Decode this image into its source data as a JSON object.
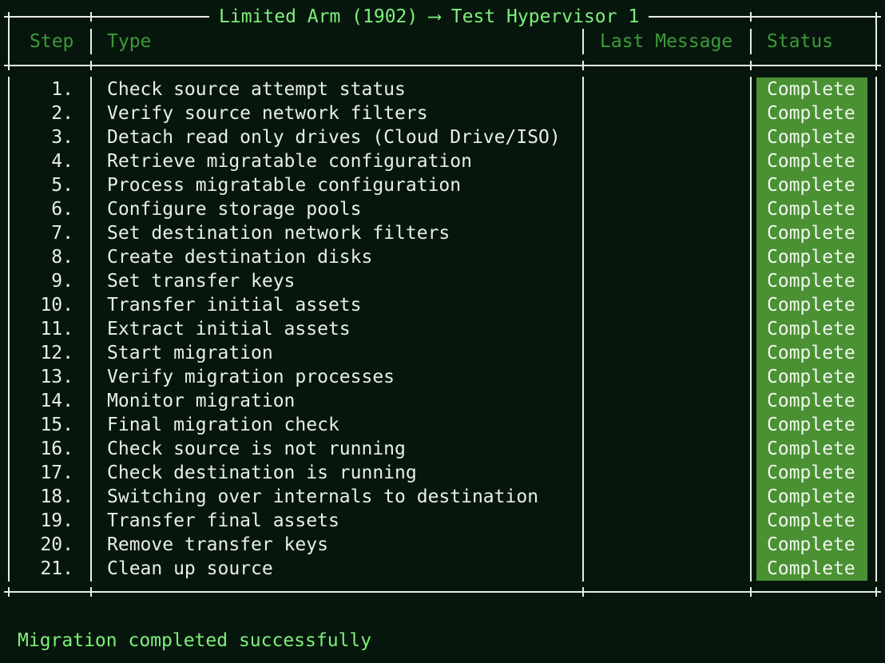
{
  "window": {
    "title": "Limited Arm (1902) ⟶ Test Hypervisor 1"
  },
  "table": {
    "headers": {
      "step": "Step",
      "type": "Type",
      "last_message": "Last Message",
      "status": "Status"
    },
    "rows": [
      {
        "step": "1.",
        "type": "Check source attempt status",
        "last_message": "",
        "status": "Complete"
      },
      {
        "step": "2.",
        "type": "Verify source network filters",
        "last_message": "",
        "status": "Complete"
      },
      {
        "step": "3.",
        "type": "Detach read only drives (Cloud Drive/ISO)",
        "last_message": "",
        "status": "Complete"
      },
      {
        "step": "4.",
        "type": "Retrieve migratable configuration",
        "last_message": "",
        "status": "Complete"
      },
      {
        "step": "5.",
        "type": "Process migratable configuration",
        "last_message": "",
        "status": "Complete"
      },
      {
        "step": "6.",
        "type": "Configure storage pools",
        "last_message": "",
        "status": "Complete"
      },
      {
        "step": "7.",
        "type": "Set destination network filters",
        "last_message": "",
        "status": "Complete"
      },
      {
        "step": "8.",
        "type": "Create destination disks",
        "last_message": "",
        "status": "Complete"
      },
      {
        "step": "9.",
        "type": "Set transfer keys",
        "last_message": "",
        "status": "Complete"
      },
      {
        "step": "10.",
        "type": "Transfer initial assets",
        "last_message": "",
        "status": "Complete"
      },
      {
        "step": "11.",
        "type": "Extract initial assets",
        "last_message": "",
        "status": "Complete"
      },
      {
        "step": "12.",
        "type": "Start migration",
        "last_message": "",
        "status": "Complete"
      },
      {
        "step": "13.",
        "type": "Verify migration processes",
        "last_message": "",
        "status": "Complete"
      },
      {
        "step": "14.",
        "type": "Monitor migration",
        "last_message": "",
        "status": "Complete"
      },
      {
        "step": "15.",
        "type": "Final migration check",
        "last_message": "",
        "status": "Complete"
      },
      {
        "step": "16.",
        "type": "Check source is not running",
        "last_message": "",
        "status": "Complete"
      },
      {
        "step": "17.",
        "type": "Check destination is running",
        "last_message": "",
        "status": "Complete"
      },
      {
        "step": "18.",
        "type": "Switching over internals to destination",
        "last_message": "",
        "status": "Complete"
      },
      {
        "step": "19.",
        "type": "Transfer final assets",
        "last_message": "",
        "status": "Complete"
      },
      {
        "step": "20.",
        "type": "Remove transfer keys",
        "last_message": "",
        "status": "Complete"
      },
      {
        "step": "21.",
        "type": "Clean up source",
        "last_message": "",
        "status": "Complete"
      }
    ]
  },
  "footer": {
    "message": "Migration completed successfully"
  },
  "colors": {
    "background": "#07160c",
    "title_green": "#7df07a",
    "header_green": "#3d9a3a",
    "status_complete_bg": "#4a9133",
    "border": "#e6eee6"
  }
}
